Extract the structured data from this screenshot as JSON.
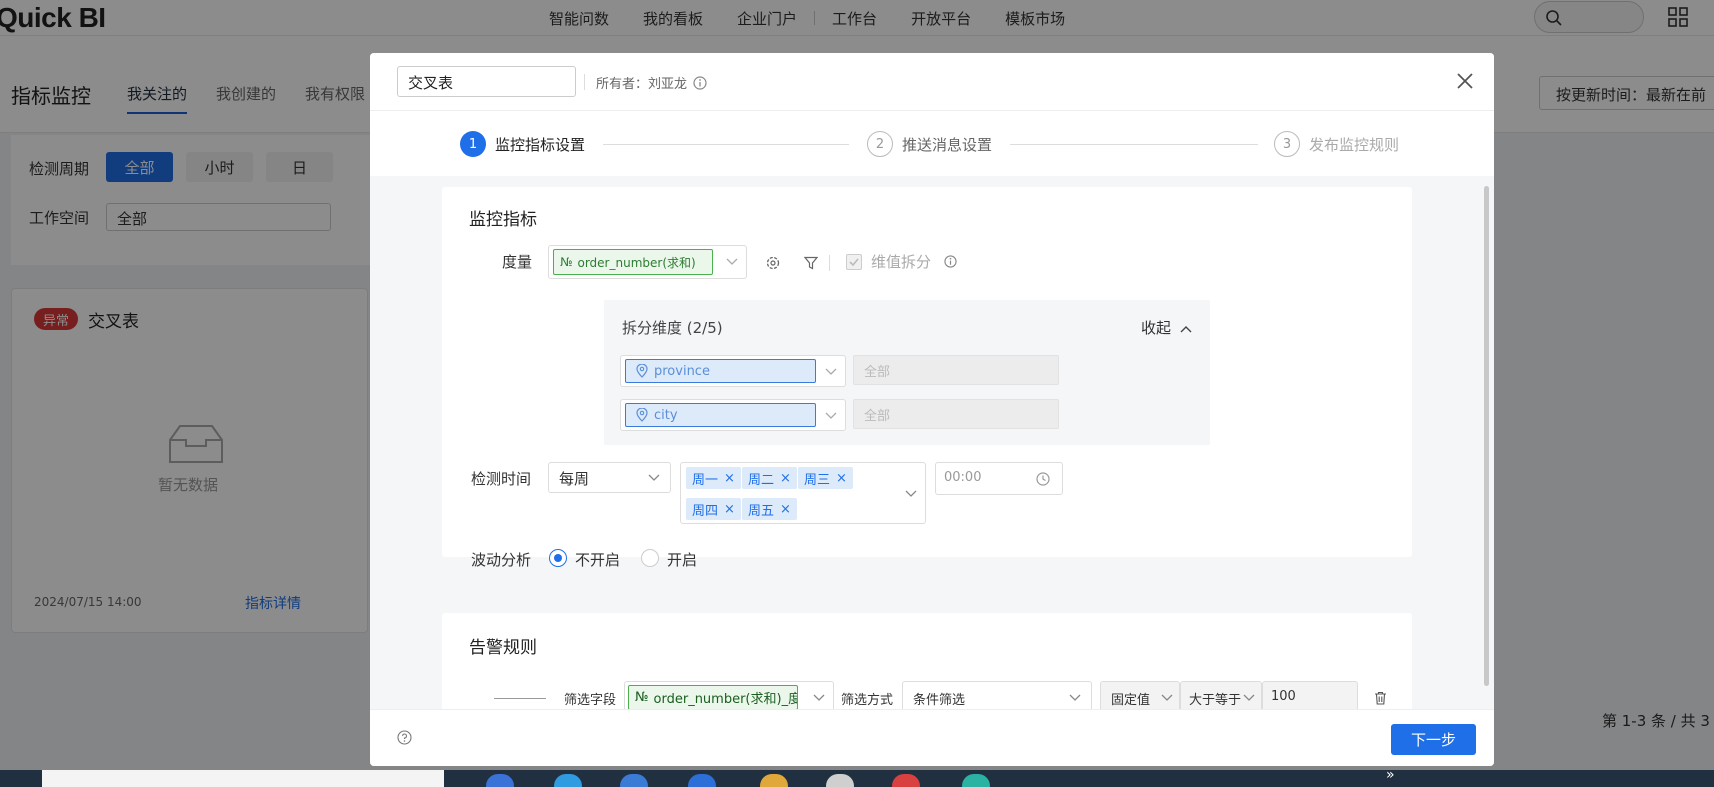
{
  "app": {
    "logo": "Quick BI"
  },
  "topnav": [
    "智能问数",
    "我的看板",
    "企业门户",
    "工作台",
    "开放平台",
    "模板市场"
  ],
  "page": {
    "title": "指标监控",
    "tabs": [
      "我关注的",
      "我创建的",
      "我有权限"
    ],
    "sort_label": "按更新时间：最新在前"
  },
  "filters": {
    "period_label": "检测周期",
    "period_options": [
      "全部",
      "小时",
      "日"
    ],
    "workspace_label": "工作空间",
    "workspace_value": "全部"
  },
  "card": {
    "status_badge": "异常",
    "title": "交叉表",
    "empty_text": "暂无数据",
    "date": "2024/07/15 14:00",
    "detail_link": "指标详情"
  },
  "pager": "第 1-3 条 / 共 3",
  "modal": {
    "name_value": "交叉表",
    "owner": "所有者：刘亚龙",
    "steps": [
      {
        "num": "1",
        "label": "监控指标设置"
      },
      {
        "num": "2",
        "label": "推送消息设置"
      },
      {
        "num": "3",
        "label": "发布监控规则"
      }
    ],
    "monitor": {
      "section_title": "监控指标",
      "measure_label": "度量",
      "measure_field": "order_number(求和)",
      "split_checkbox": "维值拆分",
      "dim_title": "拆分维度 (2/5)",
      "collapse": "收起",
      "dimensions": [
        {
          "field": "province",
          "value": "全部"
        },
        {
          "field": "city",
          "value": "全部"
        }
      ],
      "time_label": "检测时间",
      "frequency": "每周",
      "days": [
        "周一",
        "周二",
        "周三",
        "周四",
        "周五"
      ],
      "time_value": "00:00",
      "fluct_label": "波动分析",
      "fluct_options": [
        "不开启",
        "开启"
      ]
    },
    "alert": {
      "section_title": "告警规则",
      "filter_field_label": "筛选字段",
      "filter_field": "order_number(求和)_度...",
      "filter_mode_label": "筛选方式",
      "filter_mode": "条件筛选",
      "value_type": "固定值",
      "operator": "大于等于",
      "value": "100"
    },
    "next_button": "下一步"
  },
  "colors": {
    "primary": "#1f6fe8",
    "danger": "#d93a3a",
    "field_green": "#4caf50"
  }
}
